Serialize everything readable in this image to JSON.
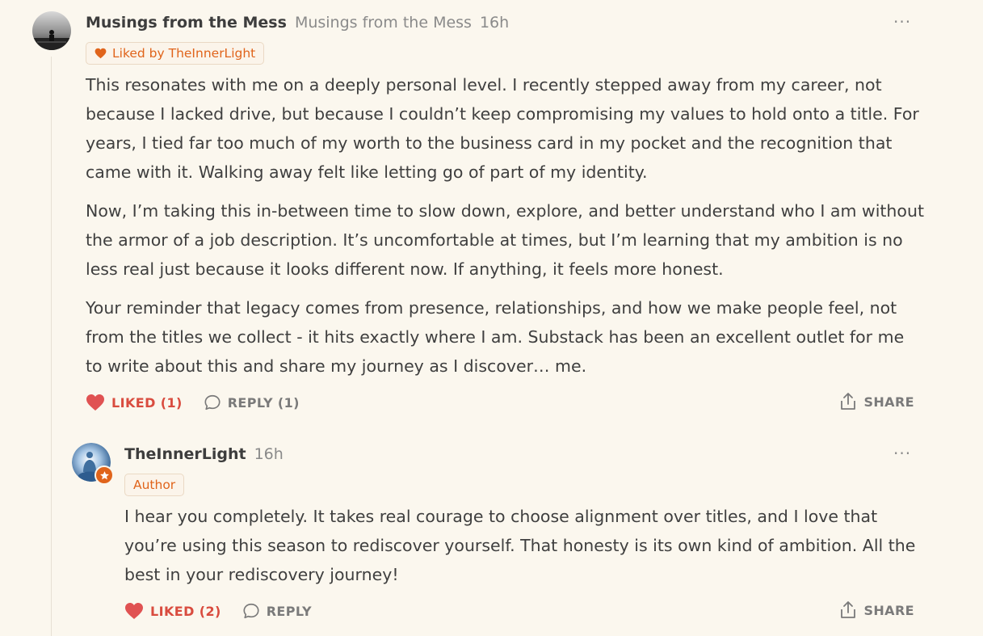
{
  "comment": {
    "author": "Musings from the Mess",
    "publication": "Musings from the Mess",
    "time": "16h",
    "more_label": "···",
    "liked_badge": "Liked by TheInnerLight",
    "paragraphs": [
      "This resonates with me on a deeply personal level. I recently stepped away from my career, not because I lacked drive, but because I couldn’t keep compromising my values to hold onto a title. For years, I tied far too much of my worth to the business card in my pocket and the recognition that came with it. Walking away felt like letting go of part of my identity.",
      "Now, I’m taking this in-between time to slow down, explore, and better understand who I am without the armor of a job description. It’s uncomfortable at times, but I’m learning that my ambition is no less real just because it looks different now. If anything, it feels more honest.",
      "Your reminder that legacy comes from presence, relationships, and how we make people feel, not from the titles we collect - it hits exactly where I am. Substack has been an excellent outlet for me to write about this and share my journey as I discover… me."
    ],
    "like_label": "LIKED (1)",
    "reply_label": "REPLY (1)",
    "share_label": "SHARE"
  },
  "reply": {
    "author": "TheInnerLight",
    "time": "16h",
    "more_label": "···",
    "author_badge": "Author",
    "paragraphs": [
      "I hear you completely. It takes real courage to choose alignment over titles, and I love that you’re using this season to rediscover yourself. That honesty is its own kind of ambition. All the best in your rediscovery journey!"
    ],
    "like_label": "LIKED (2)",
    "reply_label": "REPLY",
    "share_label": "SHARE"
  },
  "colors": {
    "background": "#fbf7ee",
    "accent": "#e0641b",
    "liked": "#d94c3f",
    "muted": "#7a7a7a"
  }
}
